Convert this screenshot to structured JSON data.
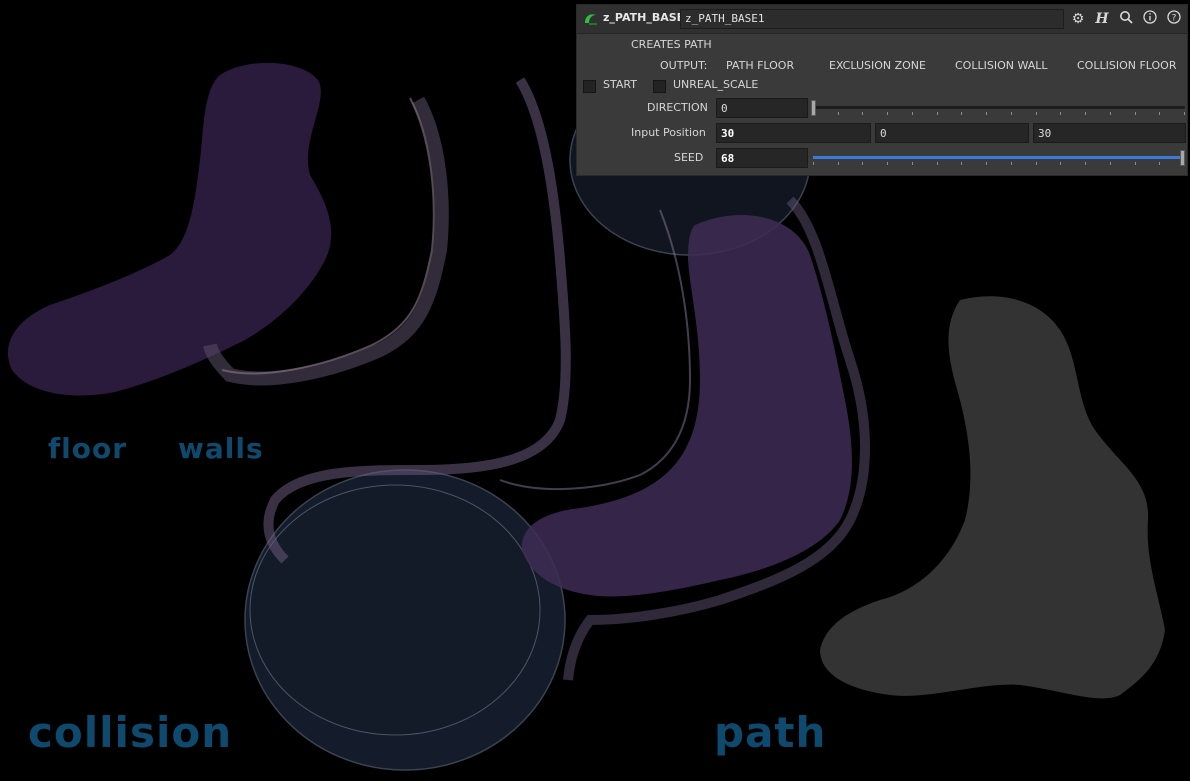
{
  "viewport": {
    "labels": {
      "floor": "floor",
      "walls": "walls",
      "collision": "collision",
      "path": "path"
    },
    "label_color": "#0e4a6e"
  },
  "panel": {
    "node_type": "z_PATH_BASE",
    "node_name": "z_PATH_BASE1",
    "icons": [
      "gear-icon",
      "houdini-h-icon",
      "magnifier-icon",
      "info-icon",
      "help-icon"
    ],
    "creates_path": "CREATES PATH",
    "output_label": "OUTPUT:",
    "outputs": [
      "PATH FLOOR",
      "EXCLUSION ZONE",
      "COLLISION WALL",
      "COLLISION FLOOR"
    ],
    "start_label": "START",
    "start_checked": false,
    "unreal_scale_label": "UNREAL_SCALE",
    "unreal_scale_checked": false,
    "direction": {
      "label": "DIRECTION",
      "value": "0",
      "slider_fraction": 0.0
    },
    "input_position": {
      "label": "Input Position",
      "x": "30",
      "y": "0",
      "z": "30"
    },
    "seed": {
      "label": "SEED",
      "value": "68",
      "slider_fraction": 1.0
    },
    "accent_color": "#3b7bd8"
  }
}
